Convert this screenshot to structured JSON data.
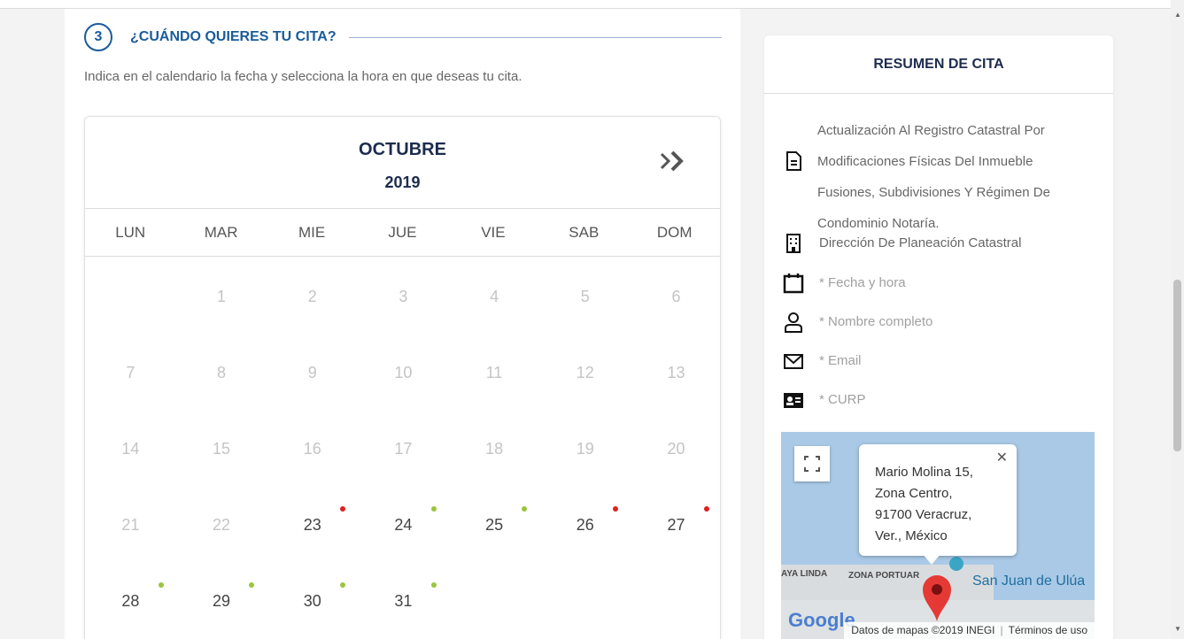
{
  "step": {
    "number": "3",
    "title": "¿CUÁNDO QUIERES TU CITA?",
    "instructions": "Indica en el calendario la fecha y selecciona la hora en que deseas tu cita."
  },
  "calendar": {
    "month": "OCTUBRE",
    "year": "2019",
    "weekdays": [
      "LUN",
      "MAR",
      "MIE",
      "JUE",
      "VIE",
      "SAB",
      "DOM"
    ],
    "days": [
      {
        "label": "",
        "active": false,
        "dot": null
      },
      {
        "label": "1",
        "active": false,
        "dot": null
      },
      {
        "label": "2",
        "active": false,
        "dot": null
      },
      {
        "label": "3",
        "active": false,
        "dot": null
      },
      {
        "label": "4",
        "active": false,
        "dot": null
      },
      {
        "label": "5",
        "active": false,
        "dot": null
      },
      {
        "label": "6",
        "active": false,
        "dot": null
      },
      {
        "label": "7",
        "active": false,
        "dot": null
      },
      {
        "label": "8",
        "active": false,
        "dot": null
      },
      {
        "label": "9",
        "active": false,
        "dot": null
      },
      {
        "label": "10",
        "active": false,
        "dot": null
      },
      {
        "label": "11",
        "active": false,
        "dot": null
      },
      {
        "label": "12",
        "active": false,
        "dot": null
      },
      {
        "label": "13",
        "active": false,
        "dot": null
      },
      {
        "label": "14",
        "active": false,
        "dot": null
      },
      {
        "label": "15",
        "active": false,
        "dot": null
      },
      {
        "label": "16",
        "active": false,
        "dot": null
      },
      {
        "label": "17",
        "active": false,
        "dot": null
      },
      {
        "label": "18",
        "active": false,
        "dot": null
      },
      {
        "label": "19",
        "active": false,
        "dot": null
      },
      {
        "label": "20",
        "active": false,
        "dot": null
      },
      {
        "label": "21",
        "active": false,
        "dot": null
      },
      {
        "label": "22",
        "active": false,
        "dot": null
      },
      {
        "label": "23",
        "active": true,
        "dot": "#e02020"
      },
      {
        "label": "24",
        "active": true,
        "dot": "#9bc53d"
      },
      {
        "label": "25",
        "active": true,
        "dot": "#9bc53d"
      },
      {
        "label": "26",
        "active": true,
        "dot": "#e02020"
      },
      {
        "label": "27",
        "active": true,
        "dot": "#e02020"
      },
      {
        "label": "28",
        "active": true,
        "dot": "#9bc53d"
      },
      {
        "label": "29",
        "active": true,
        "dot": "#9bc53d"
      },
      {
        "label": "30",
        "active": true,
        "dot": "#9bc53d"
      },
      {
        "label": "31",
        "active": true,
        "dot": "#9bc53d"
      }
    ]
  },
  "summary": {
    "title": "RESUMEN DE CITA",
    "service": "Actualización Al Registro Catastral Por Modificaciones Físicas Del Inmueble Fusiones, Subdivisiones Y Régimen De Condominio Notaría.",
    "office": "Dirección De Planeación Catastral",
    "date_field": "* Fecha y hora",
    "name_field": "* Nombre completo",
    "email_field": "* Email",
    "curp_field": "* CURP"
  },
  "map": {
    "popup_line1": "Mario Molina 15,",
    "popup_line2": "Zona Centro,",
    "popup_line3": "91700 Veracruz,",
    "popup_line4": "Ver., México",
    "label_playa": "AYA LINDA",
    "label_zona": "ZONA PORTUAR",
    "poi": "San Juan de Ulúa",
    "logo": "Google",
    "attribution": "Datos de mapas ©2019 INEGI",
    "terms": "Términos de uso"
  },
  "colors": {
    "accent_blue": "#1a5b9b",
    "available_dot": "#9bc53d",
    "unavailable_dot": "#e02020"
  }
}
